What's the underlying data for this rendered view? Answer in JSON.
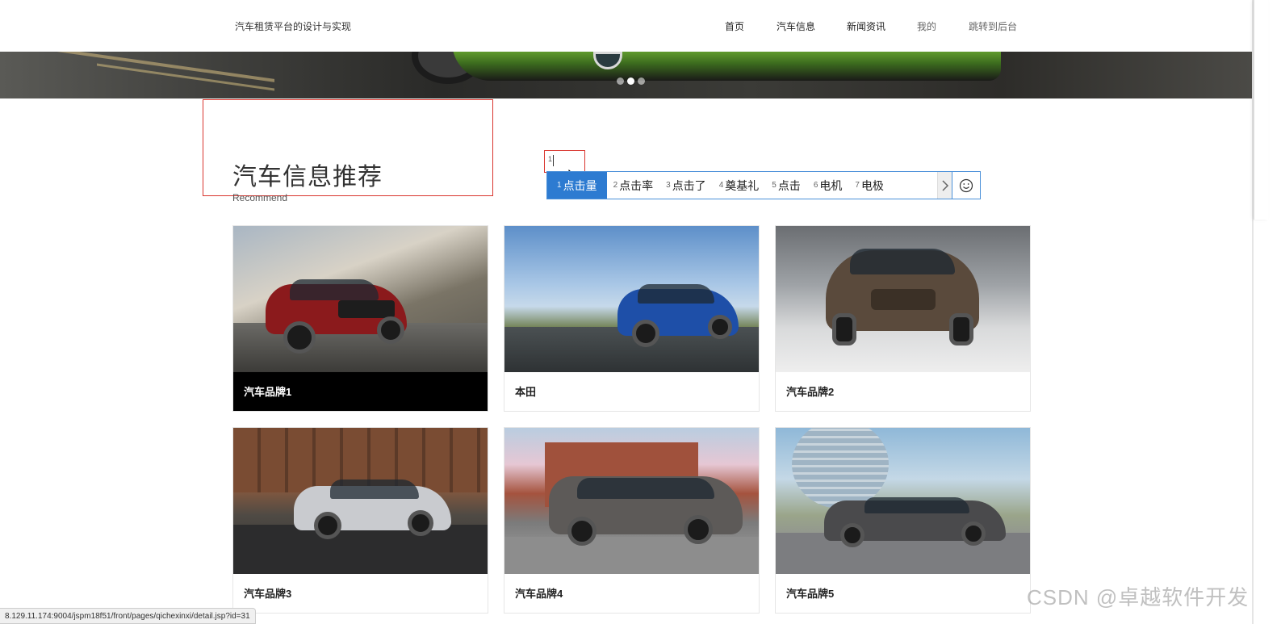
{
  "header": {
    "site_title": "汽车租赁平台的设计与实现",
    "nav": [
      {
        "label": "首页"
      },
      {
        "label": "汽车信息"
      },
      {
        "label": "新闻资讯"
      },
      {
        "label": "我的"
      },
      {
        "label": "跳转到后台"
      }
    ]
  },
  "carousel": {
    "slide_count": 3,
    "active_index": 1
  },
  "section": {
    "title": "汽车信息推荐",
    "subtitle": "Recommend"
  },
  "input": {
    "typed_text": "1"
  },
  "ime": {
    "candidates": [
      {
        "index": "1",
        "text": "点击量"
      },
      {
        "index": "2",
        "text": "点击率"
      },
      {
        "index": "3",
        "text": "点击了"
      },
      {
        "index": "4",
        "text": "奠基礼"
      },
      {
        "index": "5",
        "text": "点击"
      },
      {
        "index": "6",
        "text": "电机"
      },
      {
        "index": "7",
        "text": "电极"
      }
    ],
    "active_index": 0,
    "accent_color": "#2d7bd1"
  },
  "cards": [
    {
      "name": "汽车品牌1",
      "car_color": "#8b1a1c"
    },
    {
      "name": "本田",
      "car_color": "#1e4fa8"
    },
    {
      "name": "汽车品牌2",
      "car_color": "#5a4a3c"
    },
    {
      "name": "汽车品牌3",
      "car_color": "#c9cbcf"
    },
    {
      "name": "汽车品牌4",
      "car_color": "#5d5a58"
    },
    {
      "name": "汽车品牌5",
      "car_color": "#4a4a4c"
    }
  ],
  "status_bar": {
    "url": "8.129.11.174:9004/jspm18f51/front/pages/qichexinxi/detail.jsp?id=31"
  },
  "watermark": "CSDN @卓越软件开发",
  "colors": {
    "outline_red": "#d9352e",
    "ime_border": "#4a90d9"
  }
}
